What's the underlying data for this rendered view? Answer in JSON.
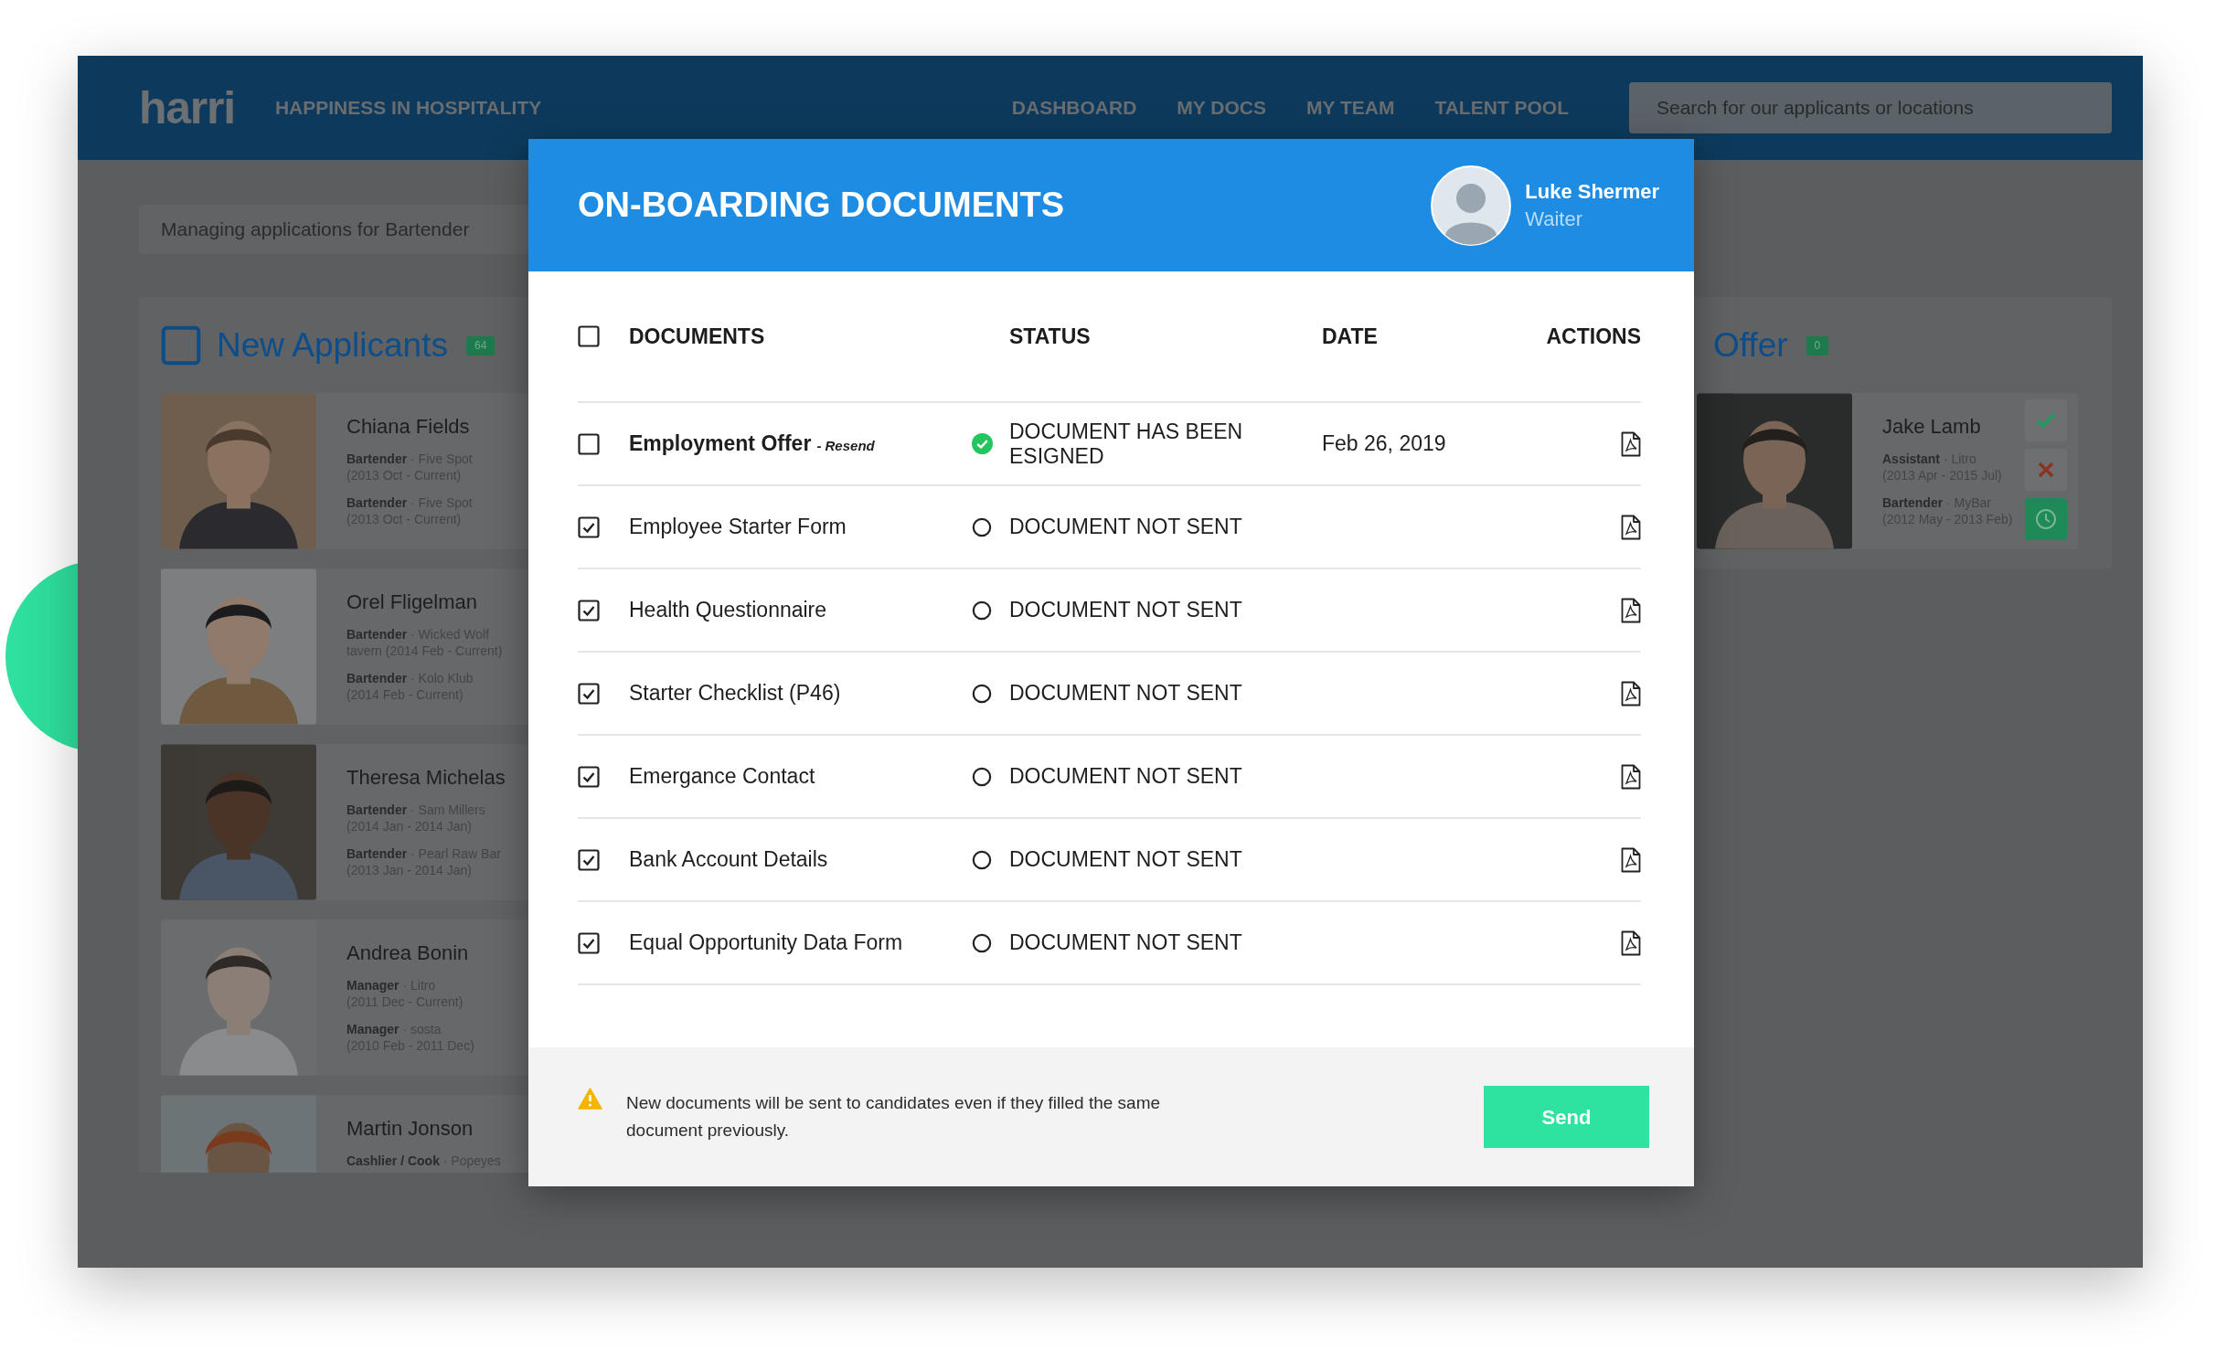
{
  "nav": {
    "logo": "harri",
    "tagline": "HAPPINESS IN HOSPITALITY",
    "links": [
      {
        "label": "DASHBOARD"
      },
      {
        "label": "MY DOCS"
      },
      {
        "label": "MY TEAM"
      },
      {
        "label": "TALENT POOL"
      }
    ],
    "search": {
      "placeholder": "Search for our applicants or locations"
    }
  },
  "context_bar": {
    "text": "Managing applications for Bartender"
  },
  "columns": [
    {
      "title": "New Applicants",
      "count": "64",
      "checked": false,
      "cards": [
        {
          "name": "Chiana Fields",
          "experience": [
            "**Bartender** · Five Spot\n(2013 Oct - Current)",
            "**Bartender** · Five Spot\n(2013 Oct - Current)"
          ]
        },
        {
          "name": "Orel Fligelman",
          "experience": [
            "**Bartender** · Wicked Wolf\ntavern (2014 Feb - Current)",
            "**Bartender** · Kolo Klub\n(2014 Feb - Current)"
          ]
        },
        {
          "name": "Theresa Michelas",
          "experience": [
            "**Bartender** · Sam Millers\n(2014 Jan - 2014 Jan)",
            "**Bartender** · Pearl Raw Bar\n(2013 Jan - 2014 Jan)"
          ]
        },
        {
          "name": "Andrea Bonin",
          "experience": [
            "**Manager** · Litro\n(2011 Dec - Current)",
            "**Manager** · sosta\n(2010 Feb - 2011 Dec)"
          ]
        },
        {
          "name": "Martin Jonson",
          "experience": [
            "**Cashlier / Cook** · Popeyes"
          ]
        }
      ]
    },
    {
      "title": "Offer",
      "count": "0",
      "cards": [
        {
          "name": "Jake Lamb",
          "experience": [
            "**Assistant** · Litro\n(2013 Apr - 2015 Jul)",
            "**Bartender** · MyBar\n(2012 May - 2013 Feb)"
          ],
          "actions": [
            {
              "kind": "accept"
            },
            {
              "kind": "reject"
            },
            {
              "kind": "schedule"
            }
          ]
        }
      ]
    }
  ],
  "modal": {
    "title": "ON-BOARDING DOCUMENTS",
    "user": {
      "name": "Luke Shermer",
      "role": "Waiter"
    },
    "table": {
      "select_all_checked": false,
      "columns": [
        "DOCUMENTS",
        "STATUS",
        "DATE",
        "ACTIONS"
      ],
      "rows": [
        {
          "checked": false,
          "document": "Employment Offer",
          "note": "- Resend",
          "status": {
            "kind": "signed",
            "text": "DOCUMENT HAS BEEN ESIGNED"
          },
          "date": "Feb 26, 2019"
        },
        {
          "checked": true,
          "document": "Employee Starter Form",
          "status": {
            "kind": "not_sent",
            "text": "DOCUMENT NOT SENT"
          }
        },
        {
          "checked": true,
          "document": "Health Questionnaire",
          "status": {
            "kind": "not_sent",
            "text": "DOCUMENT NOT SENT"
          }
        },
        {
          "checked": true,
          "document": "Starter Checklist (P46)",
          "status": {
            "kind": "not_sent",
            "text": "DOCUMENT NOT SENT"
          }
        },
        {
          "checked": true,
          "document": "Emergance Contact",
          "status": {
            "kind": "not_sent",
            "text": "DOCUMENT NOT SENT"
          }
        },
        {
          "checked": true,
          "document": "Bank Account Details",
          "status": {
            "kind": "not_sent",
            "text": "DOCUMENT NOT SENT"
          }
        },
        {
          "checked": true,
          "document": "Equal Opportunity Data Form",
          "status": {
            "kind": "not_sent",
            "text": "DOCUMENT NOT SENT"
          }
        }
      ]
    },
    "notice": "New documents will be sent to candidates even if they filled the same document previously.",
    "send_button": "Send"
  }
}
